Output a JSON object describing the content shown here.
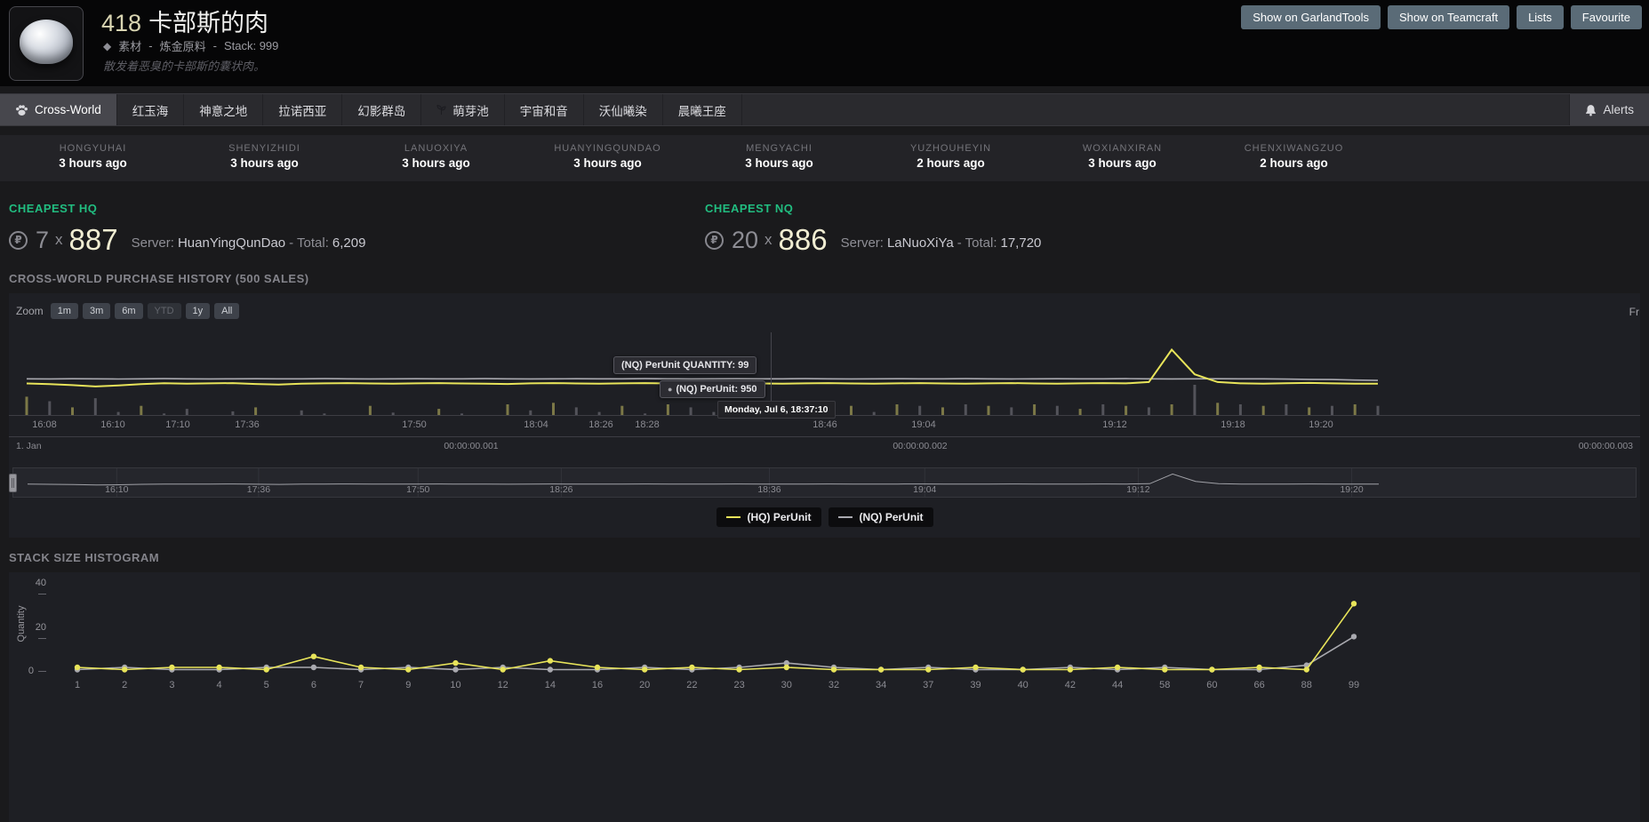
{
  "colors": {
    "cheapest_accent": "#21bd80",
    "hq_series": "#e8e45a",
    "nq_series": "#a9a9af"
  },
  "header": {
    "item_id": "418",
    "item_name": "卡部斯的肉",
    "category": "素材",
    "meta_separator": "-",
    "subcategory": "炼金原料",
    "stack": "Stack: 999",
    "description": "散发着恶臭的卡部斯的囊状肉。",
    "buttons": [
      {
        "name": "show-on-garlandtools-button",
        "label": "Show on GarlandTools"
      },
      {
        "name": "show-on-teamcraft-button",
        "label": "Show on Teamcraft"
      },
      {
        "name": "lists-button",
        "label": "Lists"
      },
      {
        "name": "favourite-button",
        "label": "Favourite"
      }
    ]
  },
  "tabs": {
    "cross_world": "Cross-World",
    "servers": [
      "红玉海",
      "神意之地",
      "拉诺西亚",
      "幻影群岛",
      "萌芽池",
      "宇宙和音",
      "沃仙曦染",
      "晨曦王座"
    ],
    "home_server": "萌芽池",
    "alerts": "Alerts"
  },
  "world_updates": [
    {
      "name": "HONGYUHAI",
      "time": "3 hours ago"
    },
    {
      "name": "SHENYIZHIDI",
      "time": "3 hours ago"
    },
    {
      "name": "LANUOXIYA",
      "time": "3 hours ago"
    },
    {
      "name": "HUANYINGQUNDAO",
      "time": "3 hours ago"
    },
    {
      "name": "MENGYACHI",
      "time": "3 hours ago"
    },
    {
      "name": "YUZHOUHEYIN",
      "time": "2 hours ago"
    },
    {
      "name": "WOXIANXIRAN",
      "time": "3 hours ago"
    },
    {
      "name": "CHENXIWANGZUO",
      "time": "2 hours ago"
    }
  ],
  "cheapest_hq": {
    "label": "CHEAPEST HQ",
    "quantity": "7",
    "multiply": "x",
    "price": "887",
    "server_prefix": "Server:",
    "server": "HuanYingQunDao",
    "total_label": "- Total:",
    "total": "6,209"
  },
  "cheapest_nq": {
    "label": "CHEAPEST NQ",
    "quantity": "20",
    "multiply": "x",
    "price": "886",
    "server_prefix": "Server:",
    "server": "LaNuoXiYa",
    "total_label": "- Total:",
    "total": "17,720"
  },
  "history": {
    "title": "CROSS-WORLD PURCHASE HISTORY (500 SALES)",
    "zoom_label": "Zoom",
    "zoom_buttons": [
      {
        "label": "1m",
        "disabled": false
      },
      {
        "label": "3m",
        "disabled": false
      },
      {
        "label": "6m",
        "disabled": false
      },
      {
        "label": "YTD",
        "disabled": true
      },
      {
        "label": "1y",
        "disabled": false
      },
      {
        "label": "All",
        "disabled": false
      }
    ],
    "range_label_clipped": "Fr",
    "tooltip_quantity": "(NQ) PerUnit QUANTITY: 99",
    "tooltip_price": "(NQ) PerUnit: 950",
    "tooltip_date": "Monday, Jul 6, 18:37:10",
    "legend": [
      {
        "label": "(HQ) PerUnit",
        "color": "#e8e45a"
      },
      {
        "label": "(NQ) PerUnit",
        "color": "#a9a9af"
      }
    ]
  },
  "histogram_section": {
    "title": "STACK SIZE HISTOGRAM",
    "ylabel": "Quantity"
  },
  "chart_data": [
    {
      "id": "purchase_history",
      "type": "line",
      "title": "CROSS-WORLD PURCHASE HISTORY (500 SALES)",
      "legend_position": "bottom-center",
      "grid": false,
      "ylim": [
        500,
        1600
      ],
      "x_ticks": [
        {
          "label": "16:08",
          "f": 0.013
        },
        {
          "label": "16:10",
          "f": 0.064
        },
        {
          "label": "17:10",
          "f": 0.112
        },
        {
          "label": "17:36",
          "f": 0.163
        },
        {
          "label": "17:50",
          "f": 0.287
        },
        {
          "label": "18:04",
          "f": 0.377
        },
        {
          "label": "18:26",
          "f": 0.425
        },
        {
          "label": "18:28",
          "f": 0.459
        },
        {
          "label": "18:46",
          "f": 0.591
        },
        {
          "label": "19:04",
          "f": 0.664
        },
        {
          "label": "19:12",
          "f": 0.805
        },
        {
          "label": "19:18",
          "f": 0.893
        },
        {
          "label": "19:20",
          "f": 0.958
        }
      ],
      "sub_axis_ticks": [
        {
          "label": "1. Jan",
          "align": "left"
        },
        {
          "label": "00:00:00.001",
          "f": 0.329
        },
        {
          "label": "00:00:00.002",
          "f": 0.661
        },
        {
          "label": "00:00:00.003",
          "align": "right"
        }
      ],
      "navigator_ticks": [
        {
          "label": "16:10",
          "f": 0.066
        },
        {
          "label": "17:36",
          "f": 0.171
        },
        {
          "label": "17:50",
          "f": 0.289
        },
        {
          "label": "18:26",
          "f": 0.395
        },
        {
          "label": "18:36",
          "f": 0.549
        },
        {
          "label": "19:04",
          "f": 0.664
        },
        {
          "label": "19:12",
          "f": 0.822
        },
        {
          "label": "19:20",
          "f": 0.98
        }
      ],
      "series": [
        {
          "name": "(HQ) PerUnit",
          "color": "#e8e45a",
          "values": [
            878,
            868,
            852,
            832,
            846,
            868,
            882,
            874,
            880,
            884,
            870,
            862,
            874,
            880,
            884,
            878,
            874,
            880,
            884,
            878,
            874,
            870,
            880,
            884,
            878,
            874,
            880,
            884,
            878,
            874,
            880,
            884,
            878,
            874,
            880,
            884,
            878,
            874,
            880,
            884,
            878,
            874,
            880,
            884,
            878,
            874,
            880,
            884,
            880,
            900,
            1400,
            1020,
            900,
            880,
            876,
            882,
            886,
            880,
            876,
            874
          ]
        },
        {
          "name": "(NQ) PerUnit",
          "color": "#a9a9af",
          "values": [
            950,
            948,
            951,
            950,
            947,
            950,
            952,
            950,
            948,
            950,
            951,
            949,
            950,
            952,
            950,
            948,
            950,
            951,
            949,
            950,
            952,
            950,
            948,
            950,
            951,
            949,
            950,
            952,
            950,
            948,
            950,
            951,
            949,
            950,
            952,
            950,
            948,
            950,
            951,
            949,
            950,
            952,
            950,
            948,
            950,
            951,
            949,
            950,
            952,
            950,
            948,
            950,
            951,
            949,
            950,
            946,
            942,
            938,
            930,
            925
          ]
        }
      ],
      "sale_quantities": [
        60,
        45,
        25,
        55,
        10,
        30,
        5,
        20,
        0,
        12,
        25,
        0,
        15,
        5,
        0,
        30,
        8,
        0,
        20,
        5,
        0,
        35,
        15,
        40,
        25,
        10,
        30,
        5,
        35,
        25,
        10,
        30,
        20,
        35,
        15,
        25,
        30,
        10,
        35,
        30,
        25,
        35,
        30,
        25,
        35,
        30,
        20,
        35,
        30,
        25,
        35,
        99,
        40,
        35,
        30,
        35,
        25,
        30,
        35,
        30
      ],
      "sale_is_hq": [
        1,
        0,
        1,
        0,
        0,
        1,
        0,
        0,
        0,
        0,
        1,
        0,
        0,
        0,
        0,
        1,
        0,
        0,
        1,
        0,
        0,
        1,
        0,
        1,
        0,
        0,
        1,
        0,
        1,
        0,
        0,
        1,
        0,
        1,
        0,
        0,
        1,
        0,
        1,
        0,
        1,
        0,
        1,
        0,
        1,
        0,
        1,
        0,
        1,
        0,
        1,
        0,
        1,
        0,
        1,
        0,
        1,
        0,
        1,
        0
      ]
    },
    {
      "id": "stack_size_histogram",
      "type": "line",
      "title": "STACK SIZE HISTOGRAM",
      "ylabel": "Quantity",
      "yticks": [
        0,
        20,
        40
      ],
      "ylim": [
        0,
        45
      ],
      "grid": false,
      "categories": [
        "1",
        "2",
        "3",
        "4",
        "5",
        "6",
        "7",
        "9",
        "10",
        "12",
        "14",
        "16",
        "20",
        "22",
        "23",
        "30",
        "32",
        "34",
        "37",
        "39",
        "40",
        "42",
        "44",
        "58",
        "60",
        "66",
        "88",
        "99"
      ],
      "series": [
        {
          "name": "HQ",
          "color": "#e8e45a",
          "values": [
            2,
            1,
            2,
            2,
            1,
            7,
            2,
            1,
            4,
            1,
            5,
            2,
            1,
            2,
            1,
            2,
            1,
            1,
            1,
            2,
            1,
            1,
            2,
            1,
            1,
            2,
            1,
            31
          ]
        },
        {
          "name": "NQ",
          "color": "#a9a9af",
          "values": [
            1,
            2,
            1,
            1,
            2,
            2,
            1,
            2,
            1,
            2,
            1,
            1,
            2,
            1,
            2,
            4,
            2,
            1,
            2,
            1,
            1,
            2,
            1,
            2,
            1,
            1,
            3,
            16
          ]
        }
      ]
    }
  ]
}
